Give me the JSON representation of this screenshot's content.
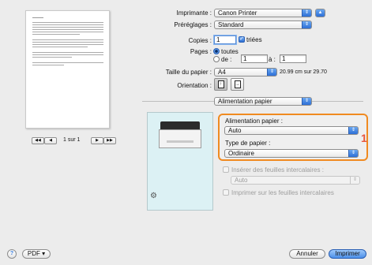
{
  "printer": {
    "label": "Imprimante :",
    "value": "Canon Printer"
  },
  "presets": {
    "label": "Préréglages :",
    "value": "Standard"
  },
  "copies": {
    "label": "Copies :",
    "value": "1",
    "collated_label": "triées"
  },
  "pages": {
    "label": "Pages :",
    "all_label": "toutes",
    "from_label": "de :",
    "from_value": "1",
    "to_label": "à :",
    "to_value": "1"
  },
  "paper_size": {
    "label": "Taille du papier :",
    "value": "A4",
    "dimensions": "20.99 cm sur 29.70"
  },
  "orientation": {
    "label": "Orientation :"
  },
  "section_popup": {
    "value": "Alimentation papier"
  },
  "paper_feed": {
    "source_label": "Alimentation papier :",
    "source_value": "Auto",
    "type_label": "Type de papier :",
    "type_value": "Ordinaire",
    "callout": "1"
  },
  "separator_sheets": {
    "label": "Insérer des feuilles intercalaires :",
    "value": "Auto"
  },
  "print_on_separators": {
    "label": "Imprimer sur les feuilles intercalaires"
  },
  "preview_nav": {
    "first": "◀◀",
    "prev": "◀",
    "page_text": "1 sur 1",
    "next": "▶",
    "last": "▶▶"
  },
  "footer": {
    "help": "?",
    "pdf_label": "PDF ▾",
    "cancel_label": "Annuler",
    "print_label": "Imprimer"
  },
  "colors": {
    "accent": "#3a7fe0",
    "callout": "#e8573d",
    "highlight": "#f08a20",
    "panel": "#dcf1f4"
  }
}
